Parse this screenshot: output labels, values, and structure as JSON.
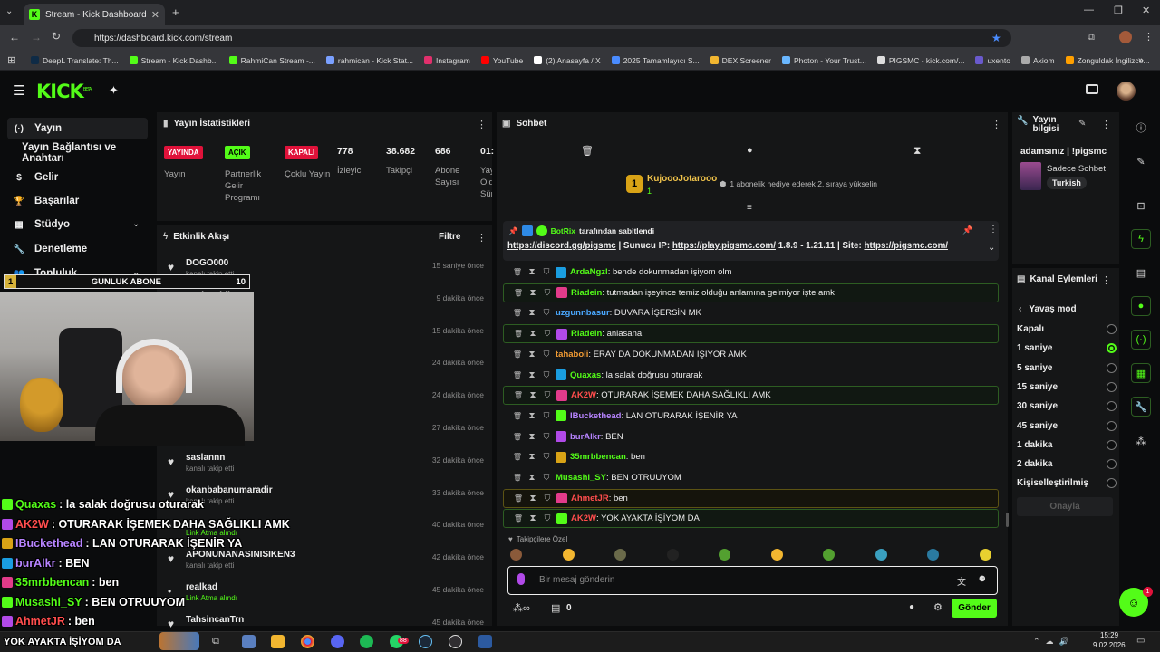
{
  "browser": {
    "tab_title": "Stream - Kick Dashboard",
    "url": "https://dashboard.kick.com/stream",
    "bookmarks": [
      "DeepL Translate: Th...",
      "Stream - Kick Dashb...",
      "RahmiCan Stream -...",
      "rahmican - Kick Stat...",
      "Instagram",
      "YouTube",
      "(2) Anasayfa / X",
      "2025 Tamamlayıcı S...",
      "DEX Screener",
      "Photon - Your Trust...",
      "PIGSMC - kick.com/...",
      "uxento",
      "Axiom",
      "Zonguldak İngilizce..."
    ]
  },
  "header": {
    "logo": "KICK",
    "logo_sup": "BETA"
  },
  "sidebar": {
    "items": [
      {
        "label": "Yayın",
        "icon": "(·)"
      },
      {
        "label": "Yayın Bağlantısı ve Anahtarı",
        "icon": ""
      },
      {
        "label": "Gelir",
        "icon": "$"
      },
      {
        "label": "Başarılar",
        "icon": "🏆"
      },
      {
        "label": "Stüdyo",
        "icon": "▦"
      },
      {
        "label": "Denetleme",
        "icon": "🔧"
      },
      {
        "label": "Topluluk",
        "icon": "👥"
      }
    ],
    "partial_item": "Dropslar ve ödüller"
  },
  "stats": {
    "title": "Yayın İstatistikleri",
    "badges": [
      {
        "text": "YAYINDA",
        "label": "Yayın",
        "color": "#e0123a"
      },
      {
        "text": "AÇIK",
        "label": "Partnerlik Gelir Programı",
        "color": "#53fc18"
      },
      {
        "text": "KAPALI",
        "label": "Çoklu Yayın",
        "color": "#e0123a"
      }
    ],
    "numbers": [
      {
        "value": "778",
        "label": "İzleyici"
      },
      {
        "value": "38.682",
        "label": "Takipçi"
      },
      {
        "value": "686",
        "label": "Abone Sayısı"
      },
      {
        "value": "01:",
        "label": "Yay Old Sür"
      }
    ]
  },
  "activity": {
    "title": "Etkinlik Akışı",
    "filter": "Filtre",
    "items": [
      {
        "name": "DOGO000",
        "sub": "kanalı takip etti",
        "time": "15 saniye önce",
        "icon": "♥"
      },
      {
        "name": "peak_addict",
        "sub": "",
        "time": "9 dakika önce",
        "icon": "♥"
      },
      {
        "name": "",
        "sub": "",
        "time": "15 dakika önce",
        "icon": ""
      },
      {
        "name": "",
        "sub": "",
        "time": "24 dakika önce",
        "icon": ""
      },
      {
        "name": "",
        "sub": "",
        "time": "24 dakika önce",
        "icon": ""
      },
      {
        "name": "",
        "sub": "kanalı takip etti",
        "time": "27 dakika önce",
        "icon": ""
      },
      {
        "name": "saslannn",
        "sub": "kanalı takip etti",
        "time": "32 dakika önce",
        "icon": "♥"
      },
      {
        "name": "okanbabanumaradir",
        "sub": "kanalı takip etti",
        "time": "33 dakika önce",
        "icon": "♥"
      },
      {
        "name": "",
        "sub": "Link Atma alındı",
        "time": "40 dakika önce",
        "icon": "•"
      },
      {
        "name": "APONUNANASINISIKEN3",
        "sub": "kanalı takip etti",
        "time": "42 dakika önce",
        "icon": "♥"
      },
      {
        "name": "realkad",
        "sub": "Link Atma alındı",
        "time": "45 dakika önce",
        "icon": "•"
      },
      {
        "name": "TahsincanTrn",
        "sub": "",
        "time": "45 dakika önce",
        "icon": "♥"
      }
    ]
  },
  "chat": {
    "title": "Sohbet",
    "gift_user": "KujoooJotarooo",
    "gift_count": "1",
    "gift_text": "1 abonelik hediye ederek 2. sıraya yükselin",
    "pinned_by": "BotRix",
    "pinned_label": "tarafından sabitlendi",
    "pinned_link1": "https://discord.gg/pigsmc",
    "pinned_mid": " | Sunucu IP: ",
    "pinned_link2": "https://play.pigsmc.com/",
    "pinned_mid2": " 1.8.9 - 1.21.11 | Site: ",
    "pinned_link3": "https://pigsmc.com/",
    "messages": [
      {
        "user": "ArdaNgzl",
        "text": ": bende dokunmadan işiyom olm",
        "color": "#53fc18",
        "hl": ""
      },
      {
        "user": "Riadein",
        "text": ": tutmadan işeyince temiz olduğu anlamına gelmiyor işte amk",
        "color": "#53fc18",
        "hl": "g"
      },
      {
        "user": "uzgunnbasur",
        "text": ": DUVARA İŞERSİN MK",
        "color": "#4aa8ff",
        "hl": ""
      },
      {
        "user": "Riadein",
        "text": ": anlasana",
        "color": "#53fc18",
        "hl": "g"
      },
      {
        "user": "tahaboli",
        "text": ": ERAY DA DOKUNMADAN İŞİYOR AMK",
        "color": "#f39c34",
        "hl": ""
      },
      {
        "user": "Quaxas",
        "text": ": la salak doğrusu oturarak",
        "color": "#53fc18",
        "hl": ""
      },
      {
        "user": "AK2W",
        "text": ": OTURARAK İŞEMEK DAHA SAĞLIKLI AMK",
        "color": "#ff4d4d",
        "hl": "g"
      },
      {
        "user": "IBuckethead",
        "text": ": LAN OTURARAK İŞENİR YA",
        "color": "#b784ff",
        "hl": ""
      },
      {
        "user": "burAlkr",
        "text": ": BEN",
        "color": "#b784ff",
        "hl": ""
      },
      {
        "user": "35mrbbencan",
        "text": ": ben",
        "color": "#53fc18",
        "hl": ""
      },
      {
        "user": "Musashi_SY",
        "text": ": BEN OTRUUYOM",
        "color": "#53fc18",
        "hl": ""
      },
      {
        "user": "AhmetJR",
        "text": ": ben",
        "color": "#ff4d4d",
        "hl": "y"
      },
      {
        "user": "AK2W",
        "text": ": YOK AYAKTA İŞİYOM DA",
        "color": "#ff4d4d",
        "hl": "g"
      }
    ],
    "followers_special": "Takipçilere Özel",
    "input_placeholder": "Bir mesaj gönderin",
    "send": "Gönder",
    "bottom_count": "0"
  },
  "stream_info": {
    "title": "Yayın bilgisi",
    "stream_title": "adamsınız | !pigsmc",
    "category": "Sadece Sohbet",
    "language": "Turkish"
  },
  "channel_actions": {
    "title": "Kanal Eylemleri",
    "slow_mode": "Yavaş mod",
    "options": [
      "Kapalı",
      "1 saniye",
      "5 saniye",
      "15 saniye",
      "30 saniye",
      "45 saniye",
      "1 dakika",
      "2 dakika",
      "Kişiselleştirilmiş"
    ],
    "selected_index": 1,
    "confirm": "Onayla"
  },
  "overlay": {
    "goal_label": "GUNLUK ABONE",
    "goal_left": "1",
    "goal_right": "10",
    "chat_lines": [
      {
        "user": "Quaxas",
        "text": " : la salak doğrusu oturarak",
        "color": "#53fc18"
      },
      {
        "user": "AK2W",
        "text": " : OTURARAK İŞEMEK DAHA SAĞLIKLI AMK",
        "color": "#ff4d4d"
      },
      {
        "user": "IBuckethead",
        "text": " : LAN OTURARAK İŞENİR YA",
        "color": "#b784ff"
      },
      {
        "user": "burAlkr",
        "text": " : BEN",
        "color": "#b784ff"
      },
      {
        "user": "35mrbbencan",
        "text": " : ben",
        "color": "#53fc18"
      },
      {
        "user": "Musashi_SY",
        "text": " : BEN OTRUUYOM",
        "color": "#53fc18"
      },
      {
        "user": "AhmetJR",
        "text": " : ben",
        "color": "#ff4d4d"
      }
    ],
    "bottom_text": "YOK AYAKTA İŞİYOM DA"
  },
  "taskbar": {
    "time": "15:29",
    "date": "9.02.2026",
    "badge": "88"
  },
  "colors": {
    "accent": "#53fc18",
    "live": "#e0123a"
  }
}
